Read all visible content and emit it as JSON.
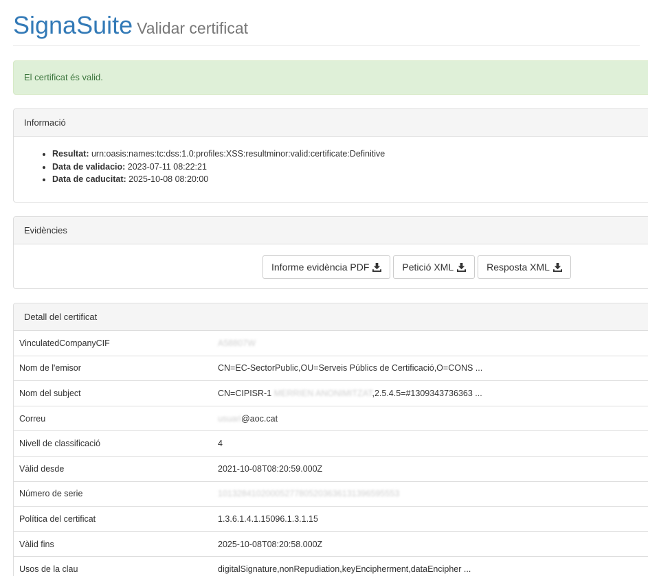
{
  "header": {
    "brand": "SignaSuite",
    "subtitle": "Validar certificat"
  },
  "alert": {
    "message": "El certificat és valid."
  },
  "info_panel": {
    "title": "Informació",
    "items": [
      {
        "label": "Resultat:",
        "value": "urn:oasis:names:tc:dss:1.0:profiles:XSS:resultminor:valid:certificate:Definitive"
      },
      {
        "label": "Data de validacio:",
        "value": "2023-07-11 08:22:21"
      },
      {
        "label": "Data de caducitat:",
        "value": "2025-10-08 08:20:00"
      }
    ]
  },
  "evidence_panel": {
    "title": "Evidències",
    "buttons": [
      {
        "label": "Informe evidència PDF",
        "icon": "download-icon"
      },
      {
        "label": "Petició XML",
        "icon": "download-icon"
      },
      {
        "label": "Resposta XML",
        "icon": "download-icon"
      }
    ]
  },
  "detail_panel": {
    "title": "Detall del certificat",
    "rows": [
      {
        "key": "VinculatedCompanyCIF",
        "value": "",
        "value_blurred": "A58807W",
        "value_suffix": ""
      },
      {
        "key": "Nom de l'emisor",
        "value": "CN=EC-SectorPublic,OU=Serveis Públics de Certificació,O=CONS ...",
        "value_blurred": "",
        "value_suffix": ""
      },
      {
        "key": "Nom del subject",
        "value": "CN=CIPISR-1 ",
        "value_blurred": "MERRIEN ANONIMITZAT",
        "value_suffix": ",2.5.4.5=#1309343736363 ..."
      },
      {
        "key": "Correu",
        "value": "",
        "value_blurred": "usuari",
        "value_suffix": "@aoc.cat"
      },
      {
        "key": "Nivell de classificació",
        "value": "4",
        "value_blurred": "",
        "value_suffix": ""
      },
      {
        "key": "Vàlid desde",
        "value": "2021-10-08T08:20:59.000Z",
        "value_blurred": "",
        "value_suffix": ""
      },
      {
        "key": "Número de serie",
        "value": "",
        "value_blurred": "10132841020005277805203636131396595553",
        "value_suffix": ""
      },
      {
        "key": "Política del certificat",
        "value": "1.3.6.1.4.1.15096.1.3.1.15",
        "value_blurred": "",
        "value_suffix": ""
      },
      {
        "key": "Vàlid fins",
        "value": "2025-10-08T08:20:58.000Z",
        "value_blurred": "",
        "value_suffix": ""
      },
      {
        "key": "Usos de la clau",
        "value": "digitalSignature,nonRepudiation,keyEncipherment,dataEncipher ...",
        "value_blurred": "",
        "value_suffix": ""
      }
    ]
  },
  "colors": {
    "brand": "#337ab7",
    "success_bg": "#dff0d8",
    "success_text": "#3c763d",
    "panel_heading_bg": "#f5f5f5",
    "border": "#dddddd"
  }
}
